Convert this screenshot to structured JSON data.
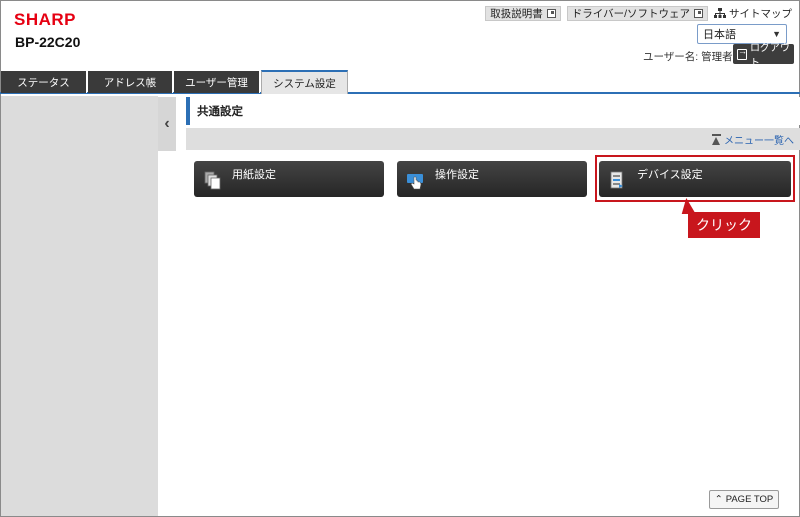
{
  "header": {
    "brand": "SHARP",
    "model": "BP-22C20",
    "links": [
      {
        "label": "取扱説明書"
      },
      {
        "label": "ドライバー/ソフトウェア"
      }
    ],
    "sitemap_label": "サイトマップ",
    "language": "日本語",
    "user_line": "ユーザー名: 管理者",
    "logout_label": "ログアウト"
  },
  "tabs": [
    {
      "label": "ステータス",
      "active": false
    },
    {
      "label": "アドレス帳",
      "active": false
    },
    {
      "label": "ユーザー管理",
      "active": false
    },
    {
      "label": "システム設定",
      "active": true
    }
  ],
  "main": {
    "section_title": "共通設定",
    "menu_link": "メニュー一覧へ",
    "buttons": [
      {
        "label": "用紙設定",
        "icon": "paper-icon"
      },
      {
        "label": "操作設定",
        "icon": "hand-touch-icon"
      },
      {
        "label": "デバイス設定",
        "icon": "device-icon"
      }
    ],
    "callout": "クリック",
    "page_top": "PAGE TOP"
  },
  "colors": {
    "brand_red": "#e60012",
    "accent_blue": "#2c6fb5",
    "highlight_red": "#c8161d",
    "tab_dark": "#3a3a3a"
  }
}
